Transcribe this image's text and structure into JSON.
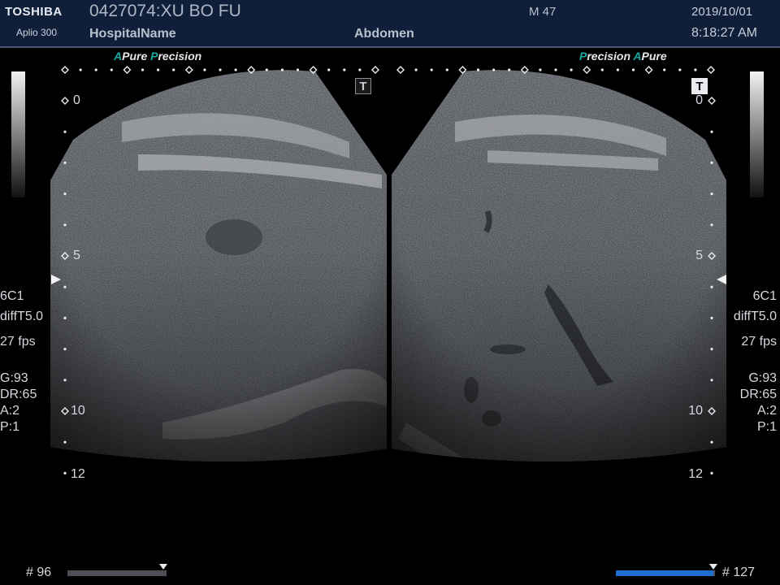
{
  "header": {
    "brand": "TOSHIBA",
    "model": "Aplio 300",
    "patient": "0427074:XU BO FU",
    "hospital": "HospitalName",
    "sex_age": "M 47",
    "exam": "Abdomen",
    "date": "2019/10/01",
    "time": "8:18:27 AM"
  },
  "left_panel": {
    "tag_a": "A",
    "tag_pure": "Pure",
    "tag_p": "P",
    "tag_precision": "recision",
    "depth_labels": [
      "0",
      "5",
      "10",
      "12"
    ],
    "probe": "6C1",
    "mode": "diffT5.0",
    "fps": "27 fps",
    "gain": "G:93",
    "dr": "DR:65",
    "a": "A:2",
    "p": "P:1",
    "t_icon": "T",
    "t_active": false
  },
  "right_panel": {
    "tag_p": "P",
    "tag_precision": "recision",
    "tag_a": "A",
    "tag_pure": "Pure",
    "depth_labels": [
      "0",
      "5",
      "10",
      "12"
    ],
    "probe": "6C1",
    "mode": "diffT5.0",
    "fps": "27 fps",
    "gain": "G:93",
    "dr": "DR:65",
    "a": "A:2",
    "p": "P:1",
    "t_icon": "T",
    "t_active": true
  },
  "footer": {
    "left_frame": "# 96",
    "right_frame": "# 127",
    "left_cine_position": 0.97,
    "right_cine_position": 0.98
  },
  "colors": {
    "header_bg": "#0f1f3a",
    "accent_teal": "#18a7a0",
    "cine_active": "#1e6fd0"
  }
}
